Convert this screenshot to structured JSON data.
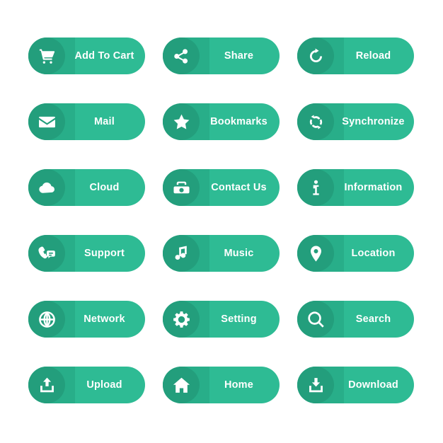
{
  "theme": {
    "background": "#ffffff",
    "button_fill": "#2ebb94",
    "icon_badge_fill": "#239e7c",
    "icon_shadow_fill": "#25a682",
    "label_color": "#ffffff"
  },
  "layout": {
    "columns": 3,
    "rows": 6,
    "total_buttons": 18
  },
  "buttons": [
    {
      "label": "Add To Cart",
      "icon": "shopping-cart-icon"
    },
    {
      "label": "Share",
      "icon": "share-nodes-icon"
    },
    {
      "label": "Reload",
      "icon": "reload-arrow-icon"
    },
    {
      "label": "Mail",
      "icon": "envelope-icon"
    },
    {
      "label": "Bookmarks",
      "icon": "star-icon"
    },
    {
      "label": "Synchronize",
      "icon": "sync-arrows-icon"
    },
    {
      "label": "Cloud",
      "icon": "cloud-icon"
    },
    {
      "label": "Contact Us",
      "icon": "telephone-icon"
    },
    {
      "label": "Information",
      "icon": "info-i-icon"
    },
    {
      "label": "Support",
      "icon": "headset-chat-icon"
    },
    {
      "label": "Music",
      "icon": "music-note-icon"
    },
    {
      "label": "Location",
      "icon": "map-pin-icon"
    },
    {
      "label": "Network",
      "icon": "globe-icon"
    },
    {
      "label": "Setting",
      "icon": "gear-icon"
    },
    {
      "label": "Search",
      "icon": "magnifying-glass-icon"
    },
    {
      "label": "Upload",
      "icon": "upload-arrow-icon"
    },
    {
      "label": "Home",
      "icon": "house-icon"
    },
    {
      "label": "Download",
      "icon": "download-arrow-icon"
    }
  ]
}
